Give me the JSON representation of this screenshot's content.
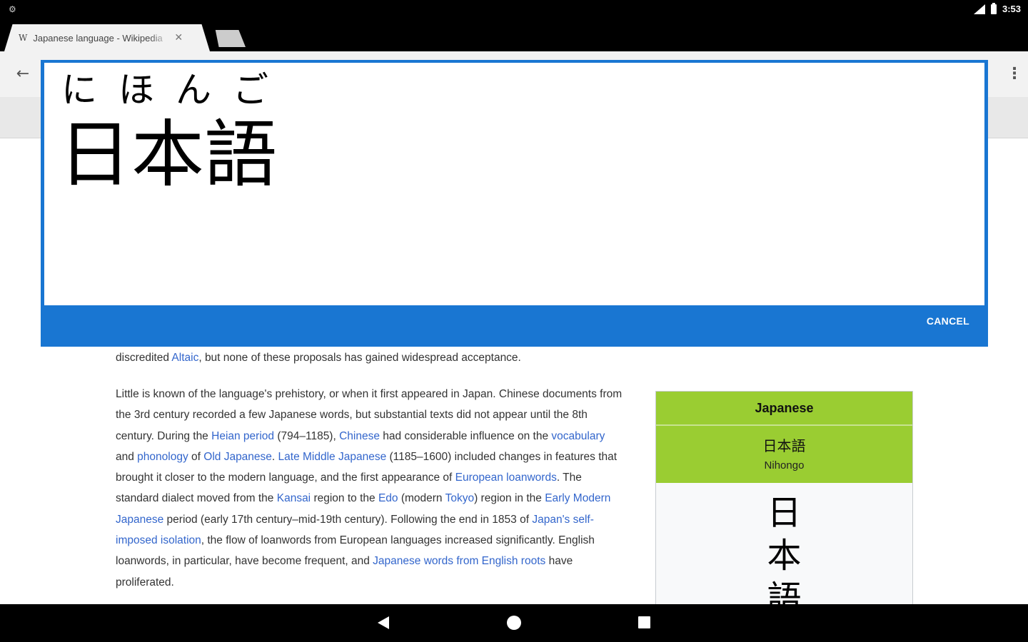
{
  "status_bar": {
    "left_icon": "⚙",
    "time": "3:53",
    "icons": [
      "signal-icon",
      "battery-icon"
    ]
  },
  "tabs": [
    {
      "favicon": "W",
      "title": "Japanese language - Wikipedia",
      "active": true
    }
  ],
  "toolbar": {
    "back_glyph": "←",
    "menu_glyph": "⋮"
  },
  "ime": {
    "furigana": "にほんご",
    "kanji": "日本語",
    "cancel_label": "CANCEL"
  },
  "article": {
    "lead": {
      "t1": "discredited ",
      "l1": "Altaic",
      "t2": ", but none of these proposals has gained widespread acceptance."
    },
    "body": {
      "t1": "Little is known of the language's prehistory, or when it first appeared in Japan. Chinese documents from the 3rd century recorded a few Japanese words, but substantial texts did not appear until the 8th century. During the ",
      "l1": "Heian period",
      "t2": " (794–1185), ",
      "l2": "Chinese",
      "t3": " had considerable influence on the ",
      "l3": "vocabulary",
      "t4": " and ",
      "l4": "phonology",
      "t5": " of ",
      "l5": "Old Japanese",
      "t6": ". ",
      "l6": "Late Middle Japanese",
      "t7": " (1185–1600) included changes in features that brought it closer to the modern language, and the first appearance of ",
      "l7": "European loanwords",
      "t8": ". The standard dialect moved from the ",
      "l8": "Kansai",
      "t9": " region to the ",
      "l9": "Edo",
      "t10": " (modern ",
      "l10": "Tokyo",
      "t11": ") region in the ",
      "l11": "Early Modern Japanese",
      "t12": " period (early 17th century–mid-19th century). Following the end in 1853 of ",
      "l12": "Japan's self-imposed isolation",
      "t13": ", the flow of loanwords from European languages increased significantly. English loanwords, in particular, have become frequent, and ",
      "l13": "Japanese words from English roots",
      "t14": " have proliferated."
    }
  },
  "infobox": {
    "title": "Japanese",
    "native_name": "日本語",
    "romanization": "Nihongo",
    "calligraphy": [
      "日",
      "本",
      "語"
    ],
    "header_color": "#9acd32"
  },
  "nav_bar": {
    "buttons": [
      "nav-back-icon",
      "nav-home-icon",
      "nav-recents-icon"
    ]
  }
}
